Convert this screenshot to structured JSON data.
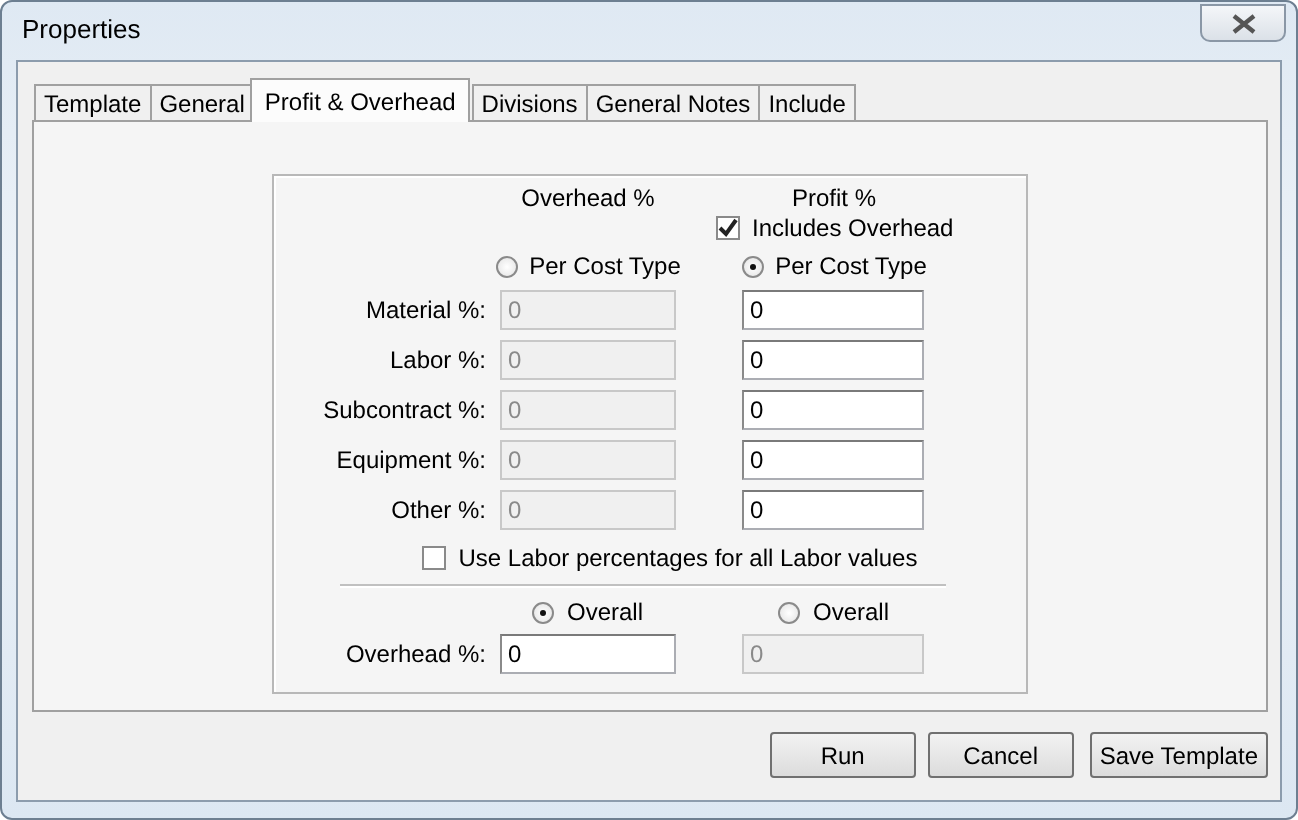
{
  "window": {
    "title": "Properties"
  },
  "tabs": [
    {
      "label": "Template",
      "selected": false
    },
    {
      "label": "General",
      "selected": false
    },
    {
      "label": "Profit & Overhead",
      "selected": true
    },
    {
      "label": "Divisions",
      "selected": false
    },
    {
      "label": "General Notes",
      "selected": false
    },
    {
      "label": "Include",
      "selected": false
    }
  ],
  "overhead_column": {
    "heading": "Overhead %",
    "mode_radio": {
      "label": "Per Cost Type",
      "selected": false
    }
  },
  "profit_column": {
    "heading": "Profit %",
    "includes_overhead": {
      "label": "Includes Overhead",
      "checked": true
    },
    "mode_radio": {
      "label": "Per Cost Type",
      "selected": true
    }
  },
  "cost_rows": [
    {
      "label": "Material %:",
      "overhead": {
        "value": "0",
        "disabled": true
      },
      "profit": {
        "value": "0",
        "disabled": false
      }
    },
    {
      "label": "Labor %:",
      "overhead": {
        "value": "0",
        "disabled": true
      },
      "profit": {
        "value": "0",
        "disabled": false
      }
    },
    {
      "label": "Subcontract %:",
      "overhead": {
        "value": "0",
        "disabled": true
      },
      "profit": {
        "value": "0",
        "disabled": false
      }
    },
    {
      "label": "Equipment %:",
      "overhead": {
        "value": "0",
        "disabled": true
      },
      "profit": {
        "value": "0",
        "disabled": false
      }
    },
    {
      "label": "Other %:",
      "overhead": {
        "value": "0",
        "disabled": true
      },
      "profit": {
        "value": "0",
        "disabled": false
      }
    }
  ],
  "use_labor": {
    "label": "Use Labor percentages for all Labor values",
    "checked": false
  },
  "overall": {
    "overhead_radio": {
      "label": "Overall",
      "selected": true
    },
    "profit_radio": {
      "label": "Overall",
      "selected": false
    },
    "label": "Overhead %:",
    "overhead": {
      "value": "0",
      "disabled": false
    },
    "profit": {
      "value": "0",
      "disabled": true
    }
  },
  "buttons": [
    "Run",
    "Cancel",
    "Save Template"
  ]
}
